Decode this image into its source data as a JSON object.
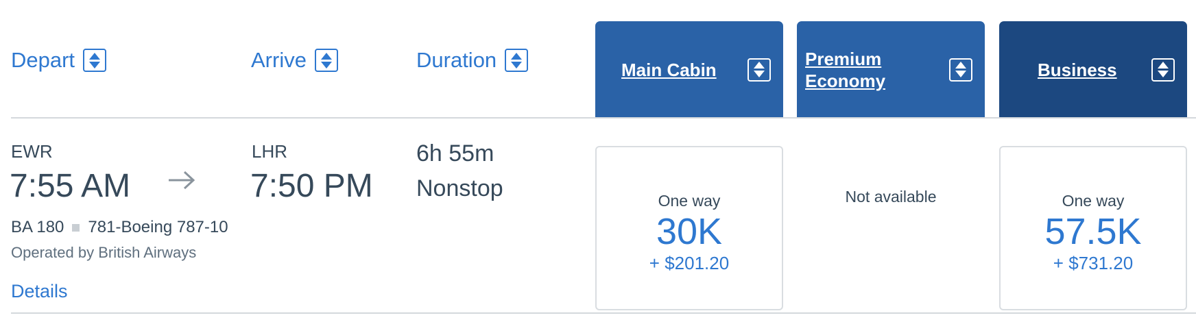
{
  "header": {
    "depart_label": "Depart",
    "arrive_label": "Arrive",
    "duration_label": "Duration",
    "cabins": [
      {
        "label": "Main Cabin",
        "color": "#2a62a7"
      },
      {
        "label": "Premium Economy",
        "color": "#2a62a7"
      },
      {
        "label": "Business",
        "color": "#1c4880"
      }
    ]
  },
  "flight": {
    "origin_code": "EWR",
    "depart_time": "7:55 AM",
    "destination_code": "LHR",
    "arrive_time": "7:50 PM",
    "duration": "6h 55m",
    "stops": "Nonstop",
    "flight_number": "BA 180",
    "aircraft": "781-Boeing 787-10",
    "operated_by": "Operated by British Airways",
    "details_link": "Details"
  },
  "fares": {
    "main_cabin": {
      "type": "One way",
      "miles": "30K",
      "tax": "+ $201.20"
    },
    "premium_economy": {
      "status": "Not available"
    },
    "business": {
      "type": "One way",
      "miles": "57.5K",
      "tax": "+ $731.20"
    }
  },
  "colors": {
    "link": "#2e78d0",
    "cabin_tab": "#2a62a7",
    "cabin_tab_business": "#1c4880",
    "rule": "#d4d8dc"
  }
}
